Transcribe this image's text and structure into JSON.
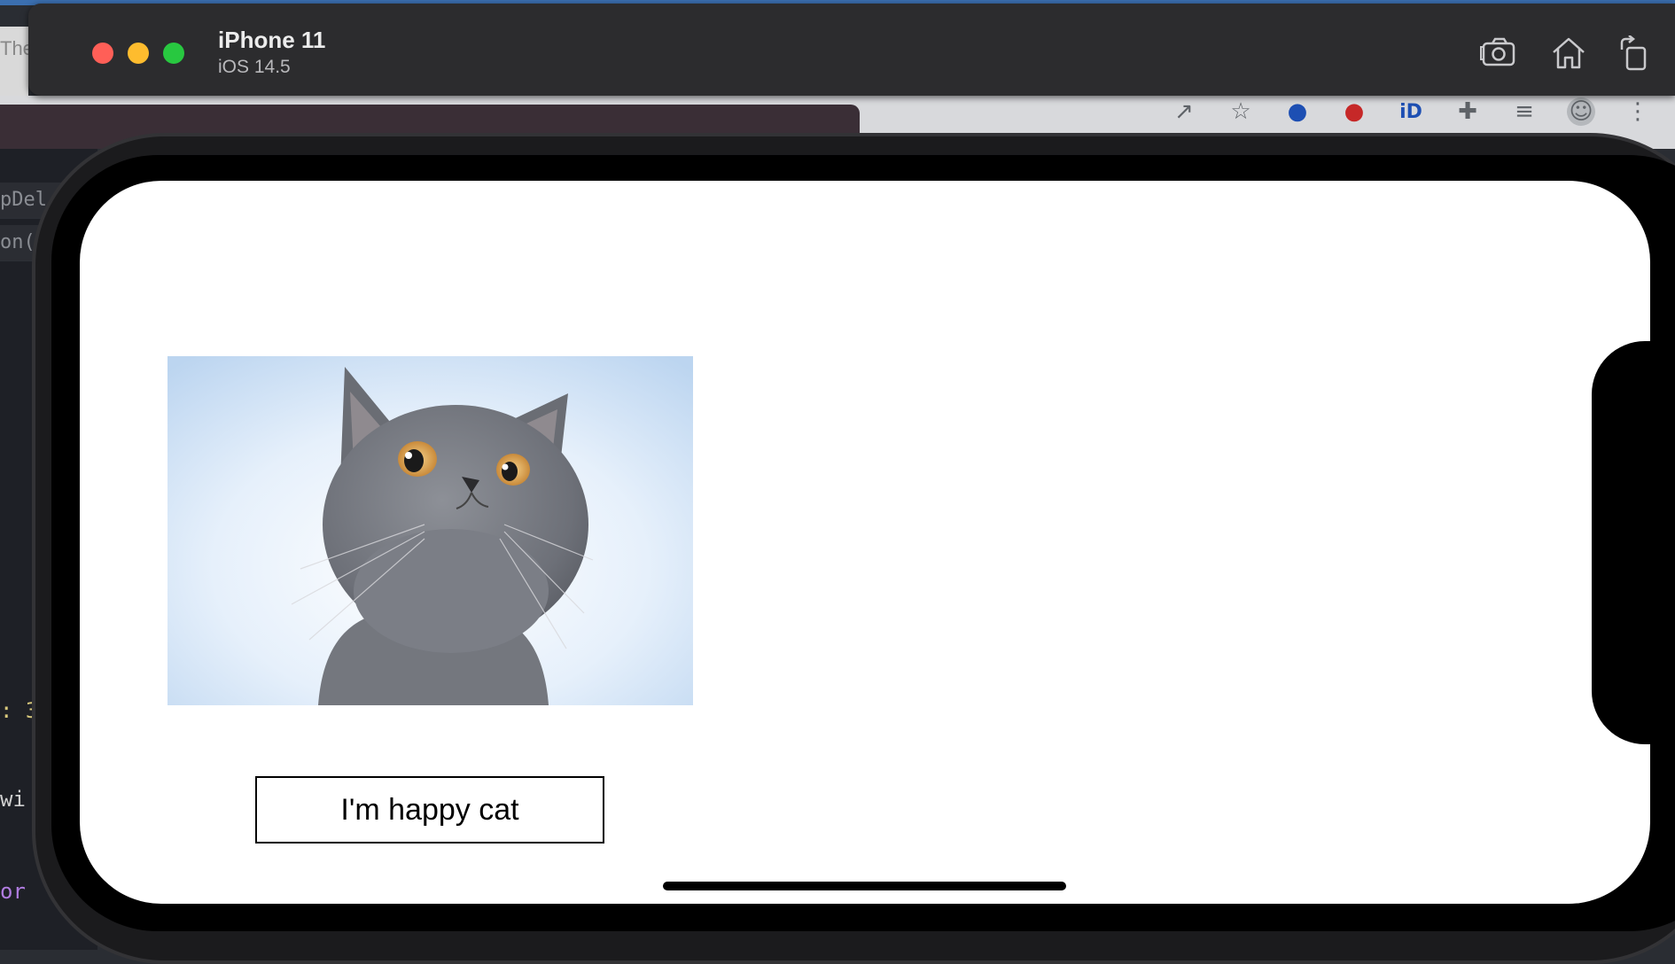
{
  "simulator": {
    "device_name": "iPhone 11",
    "os_version": "iOS 14.5",
    "buttons": [
      {
        "name": "screenshot-button",
        "icon": "camera-icon"
      },
      {
        "name": "home-button",
        "icon": "home-icon"
      },
      {
        "name": "rotate-button",
        "icon": "rotate-icon"
      }
    ]
  },
  "app": {
    "image_alt": "cat-photo",
    "button_label": "I'm happy cat"
  },
  "background": {
    "editor_left_labels": [
      "pDel",
      "on("
    ],
    "code_fragments": [
      ": 3",
      " wi",
      "or"
    ],
    "left_peek_text": "The"
  },
  "colors": {
    "traffic_red": "#ff5f57",
    "traffic_yellow": "#febc2e",
    "traffic_green": "#28c840",
    "titlebar": "#2c2c2e"
  }
}
